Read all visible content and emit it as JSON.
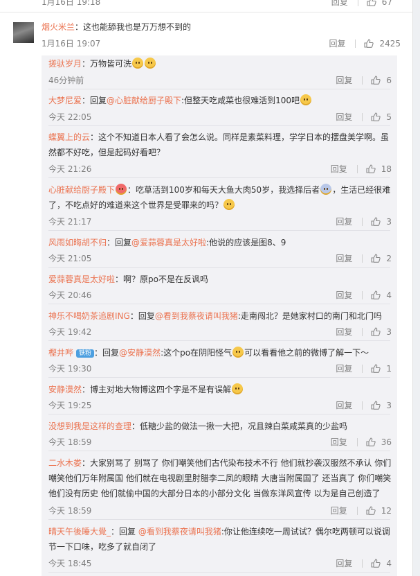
{
  "top_partial": {
    "time": "1月16日 19:18",
    "reply_label": "回复",
    "likes": "67"
  },
  "main_comment": {
    "username": "烟火米兰",
    "text": "：这也能舔我也是万万想不到的",
    "time": "1月16日 19:07",
    "reply_label": "回复",
    "likes": "2425"
  },
  "replies": [
    {
      "username": "搓驮岁月",
      "text": "：万物皆可洗",
      "time": "46分钟前",
      "reply_label": "回复",
      "likes": "6"
    },
    {
      "username": "大梦尼爱",
      "prefix": "：回复",
      "at": "@心脏献给厨子殿下",
      "text": ":但整天吃咸菜也很难活到100吧",
      "time": "今天 22:05",
      "reply_label": "回复",
      "likes": "5"
    },
    {
      "username": "蝶翼上的云",
      "text": "：这个不知道日本人看了会怎么说。同样是素菜料理，学学日本的摆盘美学啊。虽然都不好吃，但是起码好看吧？",
      "time": "今天 21:26",
      "reply_label": "回复",
      "likes": "18"
    },
    {
      "username": "心脏献给厨子殿下",
      "text1": "：吃草活到100岁和每天大鱼大肉50岁，我选择后者",
      "text2": "，生活已经很难了，不吃点好的难道来这个世界是受罪来的吗？",
      "time": "今天 21:17",
      "reply_label": "回复",
      "likes": "3"
    },
    {
      "username": "风雨如晦胡不归",
      "prefix": "：回复",
      "at": "@爱蒜蓉真是太好啦",
      "text": ":他说的应该是图8、9",
      "time": "今天 21:05",
      "reply_label": "回复",
      "likes": "2"
    },
    {
      "username": "爱蒜蓉真是太好啦",
      "text": "：啊？原po不是在反讽吗",
      "time": "今天 20:46",
      "reply_label": "回复",
      "likes": "4"
    },
    {
      "username": "神乐不喝奶茶追剧ING",
      "prefix": "：回复",
      "at": "@看到我蔡夜请叫我猪",
      "text": ":走南闯北？是她家村口的南门和北门吗",
      "time": "今天 19:42",
      "reply_label": "回复",
      "likes": "3"
    },
    {
      "username": "樫井哔",
      "badge": "铁粉",
      "prefix": "：回复",
      "at": "@安静漠然",
      "text1": ":这个po在阴阳怪气",
      "text2": "可以看看他之前的微博了解一下～",
      "time": "今天 19:30",
      "reply_label": "回复",
      "likes": "1"
    },
    {
      "username": "安静漠然",
      "text": "：博主对地大物博这四个字是不是有误解",
      "time": "今天 19:25",
      "reply_label": "回复",
      "likes": "3"
    },
    {
      "username": "没想到我是这样的查理",
      "text": "：低糖少盐的做法一揪一大把，况且辣白菜咸菜真的少盐吗",
      "time": "今天 18:59",
      "reply_label": "回复",
      "likes": "36"
    },
    {
      "username": "二水木娄",
      "text": "：大家别骂了 别骂了 你们嘲笑他们古代染布技术不行 他们就抄袭汉服然不承认 你们嘲笑他们万年附属国 他们就在电视剧里肘腊李二凤的眼睛 大唐当附属国了 还当真了 你们嘲笑他们没有历史 他们就偷中国的大部分日本的小部分文化 当做东洋风宣传 以为是自己创造了",
      "time": "今天 18:59",
      "reply_label": "回复",
      "likes": "12"
    },
    {
      "username": "晴天午後睡大覺_",
      "prefix": "：回复 ",
      "at": "@看到我蔡夜请叫我猪",
      "text": ":你让他连续吃一周试试？偶尔吃两顿可以说调节一下口味，吃多了就自闭了",
      "time": "今天 18:45",
      "reply_label": "回复",
      "likes": "4"
    }
  ]
}
